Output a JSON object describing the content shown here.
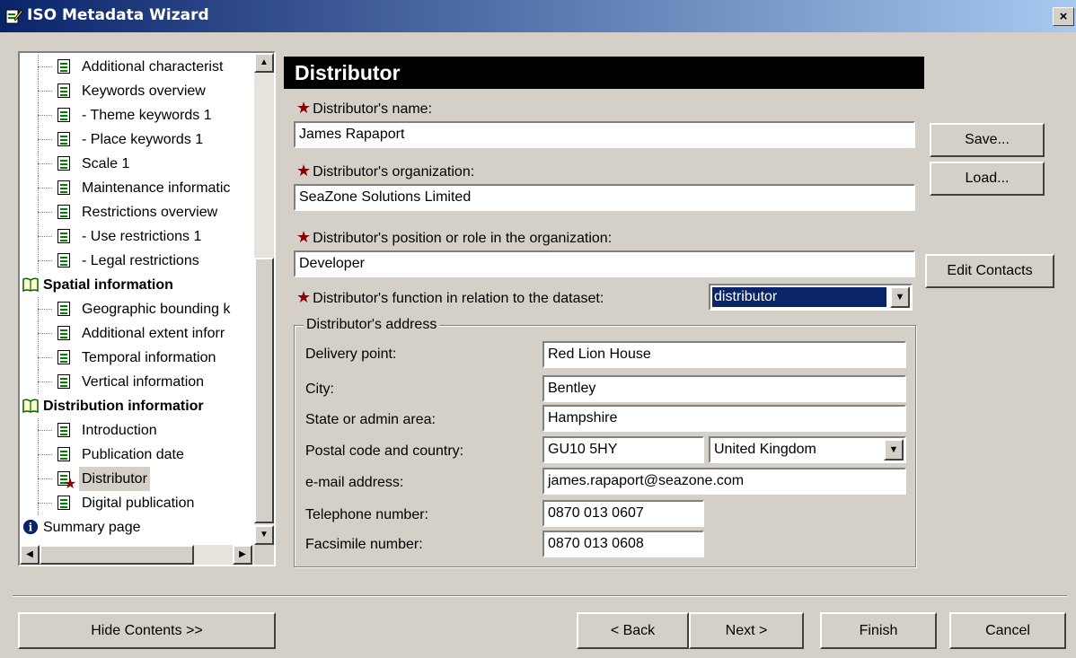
{
  "window": {
    "title": "ISO Metadata Wizard",
    "close_label": "×"
  },
  "tree": {
    "items": [
      {
        "label": "Additional characterist",
        "kind": "doc",
        "level": 1
      },
      {
        "label": "Keywords overview",
        "kind": "doc",
        "level": 1
      },
      {
        "label": "- Theme keywords 1",
        "kind": "doc",
        "level": 1
      },
      {
        "label": "- Place keywords 1",
        "kind": "doc",
        "level": 1
      },
      {
        "label": "Scale 1",
        "kind": "doc",
        "level": 1
      },
      {
        "label": "Maintenance informatic",
        "kind": "doc",
        "level": 1
      },
      {
        "label": "Restrictions overview",
        "kind": "doc",
        "level": 1
      },
      {
        "label": "- Use restrictions 1",
        "kind": "doc",
        "level": 1
      },
      {
        "label": "- Legal restrictions",
        "kind": "doc",
        "level": 1
      },
      {
        "label": "Spatial information",
        "kind": "book",
        "level": 0
      },
      {
        "label": "Geographic bounding k",
        "kind": "doc",
        "level": 1
      },
      {
        "label": "Additional extent inforr",
        "kind": "doc",
        "level": 1
      },
      {
        "label": "Temporal information",
        "kind": "doc",
        "level": 1
      },
      {
        "label": "Vertical information",
        "kind": "doc",
        "level": 1
      },
      {
        "label": "Distribution informatior",
        "kind": "book",
        "level": 0
      },
      {
        "label": "Introduction",
        "kind": "doc",
        "level": 1
      },
      {
        "label": "Publication date",
        "kind": "doc",
        "level": 1
      },
      {
        "label": "Distributor",
        "kind": "doc-required",
        "level": 1,
        "selected": true
      },
      {
        "label": "Digital publication",
        "kind": "doc",
        "level": 1
      },
      {
        "label": "Summary page",
        "kind": "info",
        "level": 0
      }
    ]
  },
  "page": {
    "header": "Distributor",
    "name_label": "Distributor's name:",
    "name_value": "James Rapaport",
    "org_label": "Distributor's organization:",
    "org_value": "SeaZone Solutions Limited",
    "position_label": "Distributor's position or role in the organization:",
    "position_value": "Developer",
    "function_label": "Distributor's function in relation to the dataset:",
    "function_value": "distributor",
    "address": {
      "legend": "Distributor's address",
      "delivery_label": "Delivery point:",
      "delivery_value": "Red Lion House",
      "city_label": "City:",
      "city_value": "Bentley",
      "state_label": "State or admin area:",
      "state_value": "Hampshire",
      "postal_label": "Postal code and country:",
      "postal_value": "GU10 5HY",
      "country_value": "United Kingdom",
      "email_label": "e-mail address:",
      "email_value": "james.rapaport@seazone.com",
      "phone_label": "Telephone number:",
      "phone_value": "0870 013 0607",
      "fax_label": "Facsimile number:",
      "fax_value": "0870 013 0608"
    }
  },
  "side_buttons": {
    "save": "Save...",
    "load": "Load...",
    "edit_contacts": "Edit Contacts"
  },
  "footer": {
    "hide_contents": "Hide Contents >>",
    "back": "< Back",
    "next": "Next >",
    "finish": "Finish",
    "cancel": "Cancel"
  },
  "colors": {
    "title_start": "#0a246a",
    "title_end": "#a6caf0",
    "required_star": "#8b0000",
    "selection": "#0a246a"
  }
}
